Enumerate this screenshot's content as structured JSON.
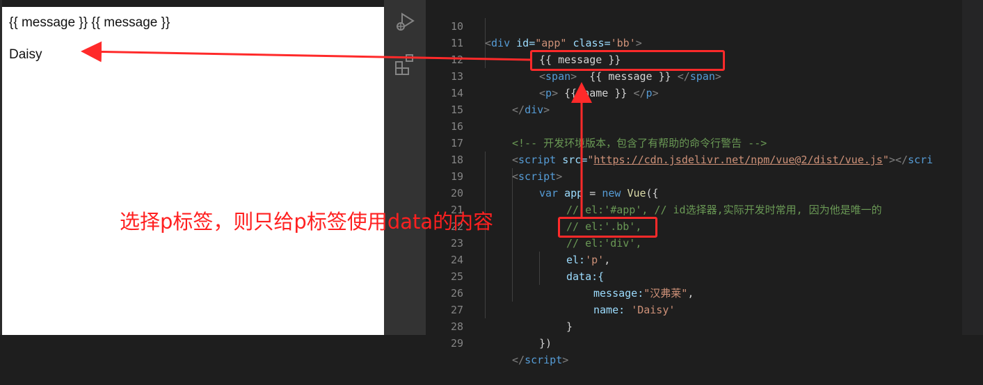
{
  "preview": {
    "line1": "{{ message }} {{ message }}",
    "line2": "Daisy"
  },
  "activity_bar": {
    "icons": [
      "run-debug-icon",
      "extensions-icon"
    ]
  },
  "editor": {
    "lines": [
      {
        "num": "10"
      },
      {
        "num": "11"
      },
      {
        "num": "12"
      },
      {
        "num": "13"
      },
      {
        "num": "14"
      },
      {
        "num": "15"
      },
      {
        "num": "16"
      },
      {
        "num": "17"
      },
      {
        "num": "18"
      },
      {
        "num": "19"
      },
      {
        "num": "20"
      },
      {
        "num": "21"
      },
      {
        "num": "22"
      },
      {
        "num": "23"
      },
      {
        "num": "24"
      },
      {
        "num": "25"
      },
      {
        "num": "26"
      },
      {
        "num": "27"
      },
      {
        "num": "28"
      },
      {
        "num": "29"
      }
    ],
    "code": {
      "l10_attr_id": "id=",
      "l10_val_id": "\"app\"",
      "l10_attr_class": "class=",
      "l10_val_class": "'bb'",
      "l11": "{{ message }}",
      "l12_text": "  {{ message }} ",
      "l13_text": " {{ name }} ",
      "l16": "<!-- 开发环境版本，包含了有帮助的命令行警告 -->",
      "l17_attr": "src=",
      "l17_url": "https://cdn.jsdelivr.net/npm/vue@2/dist/vue.js",
      "l19_kw": "var",
      "l19_var": "app",
      "l19_new": "new",
      "l19_cls": "Vue",
      "l20": "// el:'#app', // id选择器,实际开发时常用, 因为他是唯一的",
      "l21": "// el:'.bb',",
      "l22": "// el:'div',",
      "l23_key": "el:",
      "l23_val": "'p'",
      "l24": "data:{",
      "l25_key": "message:",
      "l25_val": "\"汉弗莱\"",
      "l26_key": "name: ",
      "l26_val": "'Daisy'",
      "l27": "}",
      "l28": "})"
    }
  },
  "annotation": {
    "text": "选择p标签，则只给p标签使用data的内容",
    "color": "#ff2a2a"
  }
}
